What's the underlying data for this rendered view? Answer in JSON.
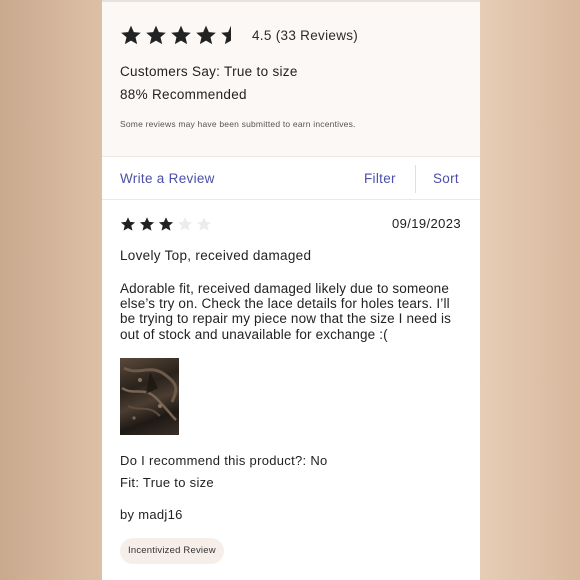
{
  "summary": {
    "rating": 4.5,
    "rating_text": "4.5 (33 Reviews)",
    "customers_say": "Customers Say: True to size",
    "recommended": "88% Recommended",
    "incentive_note": "Some reviews may have been submitted to earn incentives."
  },
  "actions": {
    "write_review": "Write a Review",
    "filter": "Filter",
    "sort": "Sort"
  },
  "review": {
    "rating": 3,
    "max_rating": 5,
    "date": "09/19/2023",
    "title": "Lovely Top, received damaged",
    "body": "Adorable fit, received damaged likely due to someone else’s try on. Check the lace details for holes tears. I’ll be trying to repair my piece now that the size I need is out of stock and unavailable for exchange :(",
    "recommend": "Do I recommend this product?: No",
    "fit": "Fit: True to size",
    "author": "by madj16",
    "badge": "Incentivized Review"
  },
  "colors": {
    "link": "#4b4fa8",
    "star": "#222222",
    "star_empty": "#e4e4e4",
    "badge_bg": "#f6efe9"
  },
  "icons": {
    "summary_stars": [
      "star-icon",
      "star-icon",
      "star-icon",
      "star-icon",
      "half-star-icon"
    ],
    "review_stars": [
      "star-icon",
      "star-icon",
      "star-icon",
      "empty-star-icon",
      "empty-star-icon"
    ]
  }
}
